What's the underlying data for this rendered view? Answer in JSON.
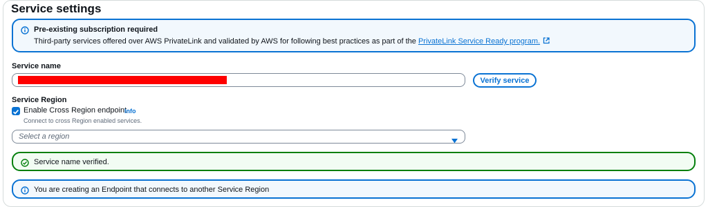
{
  "section": {
    "title": "Service settings"
  },
  "subscription_alert": {
    "heading": "Pre-existing subscription required",
    "text": "Third-party services offered over AWS PrivateLink and validated by AWS for following best practices as part of the ",
    "link_text": "PrivateLink Service Ready program.",
    "icon": "info-icon",
    "link_icon": "external-link-icon"
  },
  "service_name": {
    "label": "Service name",
    "value_redacted": true,
    "verify_button": "Verify service"
  },
  "service_region": {
    "label": "Service Region",
    "cross_region_checkbox": {
      "label": "Enable Cross Region endpoint",
      "checked": true,
      "info": "Info",
      "description": "Connect to cross Region enabled services."
    },
    "select": {
      "placeholder": "Select a region"
    }
  },
  "verified_alert": {
    "text": "Service name verified.",
    "icon": "check-circle-icon"
  },
  "region_alert": {
    "text": "You are creating an Endpoint that connects to another Service Region",
    "icon": "info-icon"
  },
  "colors": {
    "accent": "#0972d3",
    "success": "#037f0c",
    "redaction": "#ff0000",
    "text": "#0f141a",
    "muted": "#5f6b7a"
  }
}
